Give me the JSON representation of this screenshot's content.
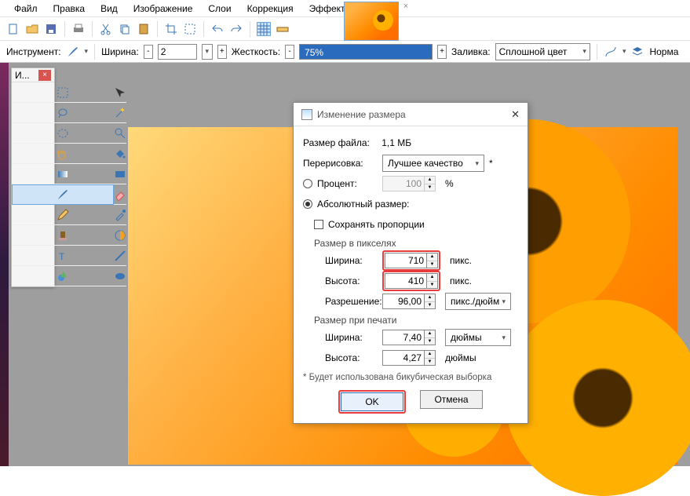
{
  "menu": {
    "file": "Файл",
    "edit": "Правка",
    "view": "Вид",
    "image": "Изображение",
    "layers": "Слои",
    "adjust": "Коррекция",
    "effects": "Эффекты"
  },
  "optionbar": {
    "tool_label": "Инструмент:",
    "width_label": "Ширина:",
    "width_value": "2",
    "hardness_label": "Жесткость:",
    "hardness_value": "75%",
    "fill_label": "Заливка:",
    "fill_value": "Сплошной цвет",
    "blend_label": "Норма"
  },
  "toolbox": {
    "title": "И..."
  },
  "dialog": {
    "title": "Изменение размера",
    "filesize_label": "Размер файла:",
    "filesize_value": "1,1 МБ",
    "resampling_label": "Перерисовка:",
    "resampling_value": "Лучшее качество",
    "asterisk": "*",
    "percent_label": "Процент:",
    "percent_value": "100",
    "percent_unit": "%",
    "absolute_label": "Абсолютный размер:",
    "aspect_label": "Сохранять пропорции",
    "px_section": "Размер в пикселях",
    "width_label": "Ширина:",
    "width_value": "710",
    "px_unit": "пикс.",
    "height_label": "Высота:",
    "height_value": "410",
    "res_label": "Разрешение:",
    "res_value": "96,00",
    "res_unit": "пикс./дюйм",
    "print_section": "Размер при печати",
    "pwidth_value": "7,40",
    "punit": "дюймы",
    "pheight_value": "4,27",
    "note": "* Будет использована бикубическая выборка",
    "ok": "OK",
    "cancel": "Отмена"
  }
}
